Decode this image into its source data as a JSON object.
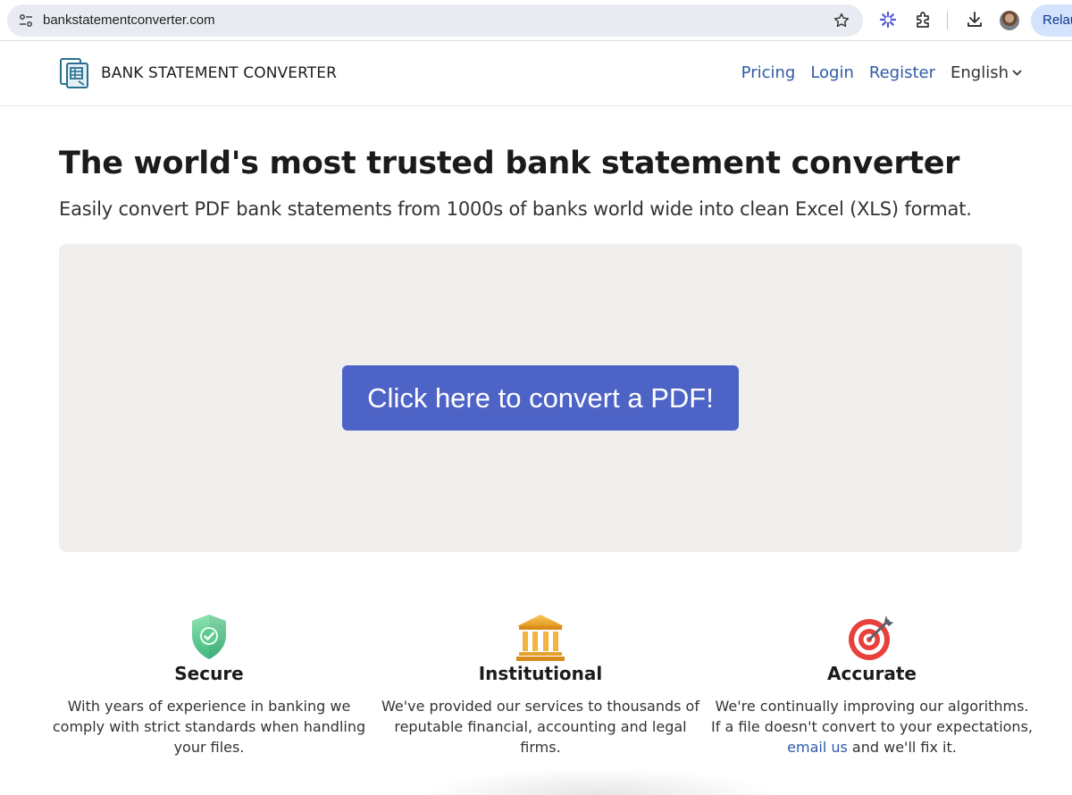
{
  "browser": {
    "url": "bankstatementconverter.com",
    "relaunch_label": "Relau",
    "icons": [
      "site-info-icon",
      "bookmark-star-icon",
      "extension-sparkle-icon",
      "puzzle-icon",
      "download-icon",
      "avatar"
    ]
  },
  "header": {
    "brand_name": "BANK STATEMENT CONVERTER",
    "logo_icon": "spreadsheet-document-icon",
    "nav": {
      "pricing": "Pricing",
      "login": "Login",
      "register": "Register",
      "language": "English"
    }
  },
  "hero": {
    "title": "The world's most trusted bank statement converter",
    "subtitle": "Easily convert PDF bank statements from 1000s of banks world wide into clean Excel (XLS) format.",
    "cta_label": "Click here to convert a PDF!"
  },
  "features": [
    {
      "icon": "shield-check-icon",
      "title": "Secure",
      "text": "With years of experience in banking we comply with strict standards when handling your files."
    },
    {
      "icon": "bank-building-icon",
      "title": "Institutional",
      "text": "We've provided our services to thousands of reputable financial, accounting and legal firms."
    },
    {
      "icon": "target-dart-icon",
      "title": "Accurate",
      "text_before": "We're continually improving our algorithms. If a file doesn't convert to your expectations,",
      "link": "email us",
      "text_after": "and we'll fix it."
    }
  ],
  "colors": {
    "accent": "#4e63c6",
    "link": "#2f5aa8",
    "panel": "#f0efee"
  }
}
